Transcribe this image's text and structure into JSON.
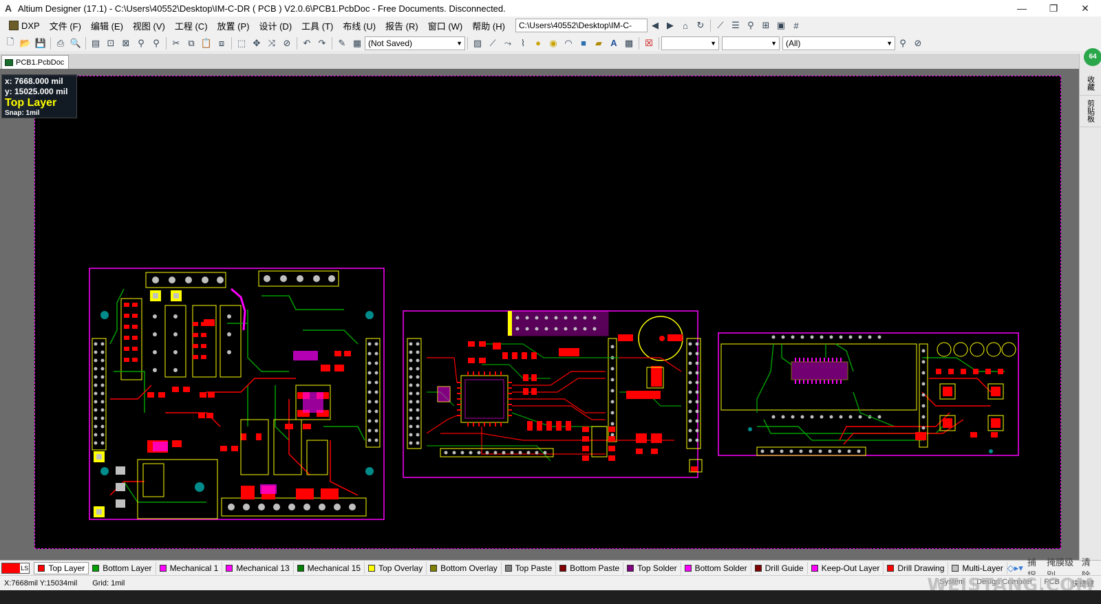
{
  "window": {
    "title": "Altium Designer (17.1) - C:\\Users\\40552\\Desktop\\IM-C-DR ( PCB ) V2.0.6\\PCB1.PcbDoc - Free Documents. Disconnected.",
    "controls": {
      "minimize": "—",
      "maximize": "❐",
      "close": "✕"
    }
  },
  "menubar": {
    "dxp_label": "DXP",
    "items": [
      "文件 (F)",
      "编辑 (E)",
      "视图 (V)",
      "工程 (C)",
      "放置 (P)",
      "设计 (D)",
      "工具 (T)",
      "布线 (U)",
      "报告 (R)",
      "窗口 (W)",
      "帮助 (H)"
    ],
    "path_combo": "C:\\Users\\40552\\Desktop\\IM-C-"
  },
  "toolbar": {
    "variant_combo": "(Not Saved)",
    "filter_combo": "(All)"
  },
  "document_tab": {
    "label": "PCB1.PcbDoc"
  },
  "hud": {
    "x": "x:  7668.000  mil",
    "y": "y: 15025.000  mil",
    "layer": "Top Layer",
    "snap": "Snap: 1mil"
  },
  "right_panel": {
    "badge": "64",
    "tabs": [
      "收藏",
      "剪贴板"
    ]
  },
  "layers": {
    "ls_label": "LS",
    "items": [
      {
        "label": "Top Layer",
        "color": "#ff0000",
        "active": true
      },
      {
        "label": "Bottom Layer",
        "color": "#00a000"
      },
      {
        "label": "Mechanical 1",
        "color": "#ff00ff"
      },
      {
        "label": "Mechanical 13",
        "color": "#ff00ff"
      },
      {
        "label": "Mechanical 15",
        "color": "#008000"
      },
      {
        "label": "Top Overlay",
        "color": "#ffff00"
      },
      {
        "label": "Bottom Overlay",
        "color": "#808000"
      },
      {
        "label": "Top Paste",
        "color": "#808080"
      },
      {
        "label": "Bottom Paste",
        "color": "#800000"
      },
      {
        "label": "Top Solder",
        "color": "#800080"
      },
      {
        "label": "Bottom Solder",
        "color": "#ff00ff"
      },
      {
        "label": "Drill Guide",
        "color": "#800000"
      },
      {
        "label": "Keep-Out Layer",
        "color": "#ff00ff"
      },
      {
        "label": "Drill Drawing",
        "color": "#ff0000"
      },
      {
        "label": "Multi-Layer",
        "color": "#c0c0c0"
      }
    ],
    "snap_button": "捕捉",
    "mask_button": "掩膜级别",
    "clear_button": "清除"
  },
  "statusbar": {
    "position": "X:7668mil Y:15034mil",
    "grid": "Grid: 1mil",
    "right_items": [
      "System",
      "Design Compiler",
      "PCB",
      "快捷键"
    ]
  },
  "watermark": "WEISTANG.COM",
  "colors": {
    "board_outline": "#ff00ff",
    "top_layer": "#ff0000",
    "bottom_layer": "#00a000",
    "overlay": "#ffff00",
    "pad": "#c0c0c0",
    "via": "#008b8b"
  }
}
